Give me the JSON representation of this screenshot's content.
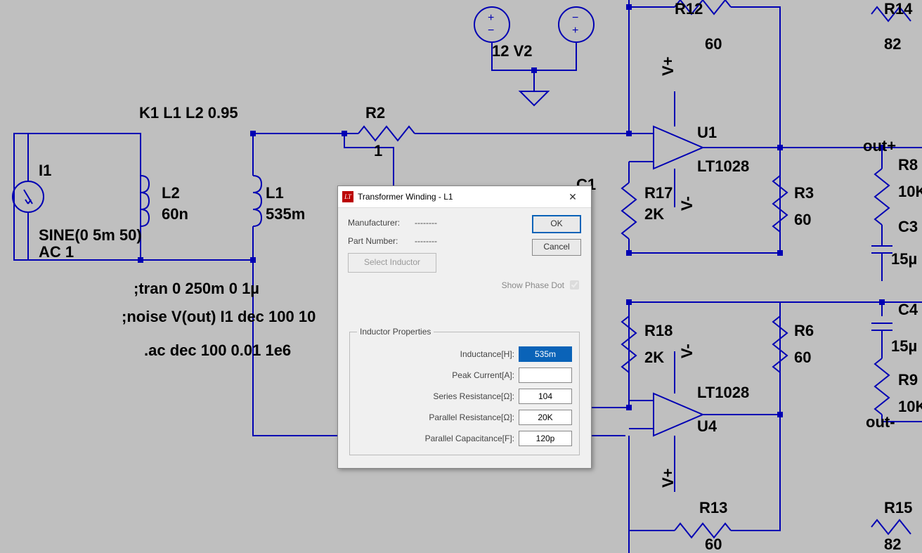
{
  "schematic": {
    "labels": {
      "k_stmt": "K1 L1 L2 0.95",
      "i1": "I1",
      "sine": "SINE(0 5m 50)",
      "ac": "AC 1",
      "l2": "L2",
      "l2v": "60n",
      "l1": "L1",
      "l1v": "535m",
      "r2": "R2",
      "r2v": "1",
      "c1": "C1",
      "vsrc": "12 V2",
      "r12": "R12",
      "r12v": "60",
      "r14": "R14",
      "r14v": "82",
      "u1": "U1",
      "u1p": "LT1028",
      "r17": "R17",
      "r17v": "2K",
      "r3": "R3",
      "r3v": "60",
      "r8": "R8",
      "r8v": "10K",
      "c3": "C3",
      "c3v": "15µ",
      "outp": "out+",
      "r18": "R18",
      "r18v": "2K",
      "r6": "R6",
      "r6v": "60",
      "c4": "C4",
      "c4v": "15µ",
      "r9": "R9",
      "r9v": "10K",
      "outm": "out-",
      "u4": "U4",
      "u4p": "LT1028",
      "r13": "R13",
      "r13v": "60",
      "r15": "R15",
      "r15v": "82",
      "vplus_top": "V+",
      "vminus_top": "V-",
      "vplus_bot": "V+",
      "vminus_bot": "V-",
      "tran": ";tran 0 250m 0 1µ",
      "noise": ";noise V(out) I1 dec 100 10",
      "acdec": ".ac dec 100 0.01 1e6"
    }
  },
  "dialog": {
    "title": "Transformer Winding - L1",
    "manufacturer_label": "Manufacturer:",
    "manufacturer_value": "--------",
    "partno_label": "Part Number:",
    "partno_value": "--------",
    "select_inductor": "Select Inductor",
    "ok": "OK",
    "cancel": "Cancel",
    "show_phase": "Show Phase Dot",
    "group": "Inductor Properties",
    "props": {
      "inductance_label": "Inductance[H]:",
      "inductance_value": "535m",
      "peak_label": "Peak Current[A]:",
      "peak_value": "",
      "series_label": "Series Resistance[Ω]:",
      "series_value": "104",
      "parallelR_label": "Parallel Resistance[Ω]:",
      "parallelR_value": "20K",
      "parallelC_label": "Parallel Capacitance[F]:",
      "parallelC_value": "120p"
    }
  }
}
